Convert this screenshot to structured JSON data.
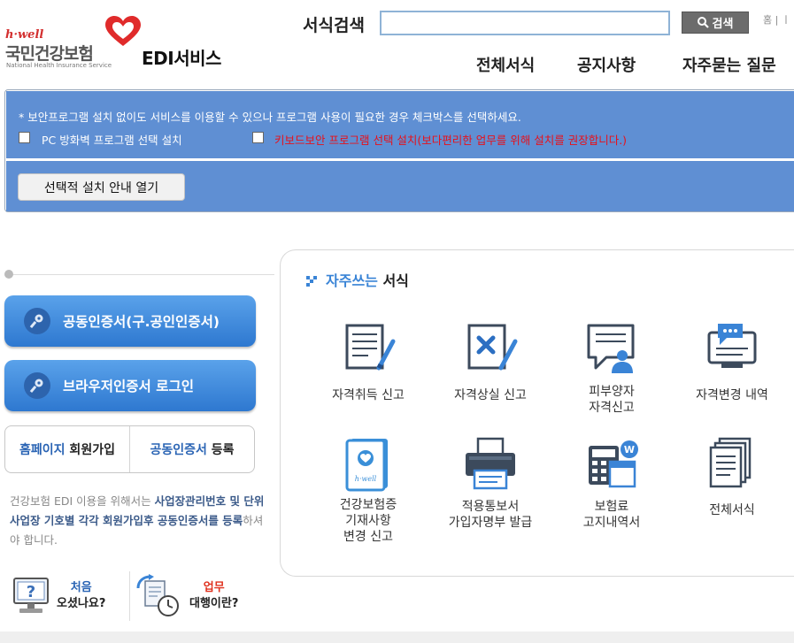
{
  "header": {
    "logo_brand": "h·well",
    "logo_org": "국민건강보험",
    "logo_org_en": "National Health Insurance Service",
    "service_title": "EDI서비스",
    "search_label": "서식검색",
    "search_value": "",
    "search_button": "검색",
    "top_links": "홈 | ㅣ"
  },
  "nav": {
    "items": [
      {
        "label": "전체서식"
      },
      {
        "label": "공지사항"
      },
      {
        "label": "자주묻는 질문"
      }
    ]
  },
  "security": {
    "note": "* 보안프로그램 설치 없이도 서비스를 이용할 수 있으나 프로그램 사용이 필요한 경우 체크박스를 선택하세요.",
    "firewall_label": "PC 방화벽 프로그램 선택 설치",
    "keyboard_label": "키보드보안 프로그램 선택 설치(보다편리한 업무를 위해 설치를 권장합니다.)",
    "guide_button": "선택적 설치 안내 열기",
    "firewall_checked": false,
    "keyboard_checked": false
  },
  "login": {
    "joint_cert": "공동인증서(구.공인인증서)",
    "browser_cert": "브라우저인증서 로그인",
    "signup_hl": "홈페이지",
    "signup_rest": " 회원가입",
    "register_hl": "공동인증서",
    "register_rest": " 등록",
    "info_1": "건강보험 EDI 이용을 위해서는 ",
    "info_2": "사업장관리번호 및 단위 사업장 기호별 각각 회원가입후 공동인증서를 등록",
    "info_3": "하셔야 합니다.",
    "first_a": "처음",
    "first_b": "오셨나요?",
    "agency_a": "업무",
    "agency_b": "대행이란?"
  },
  "freq": {
    "title_a": "자주쓰는",
    "title_b": " 서식",
    "items": [
      {
        "label": "자격취득 신고",
        "icon": "document-pen-icon"
      },
      {
        "label": "자격상실 신고",
        "icon": "document-x-icon"
      },
      {
        "label": "피부양자\n자격신고",
        "icon": "person-board-icon"
      },
      {
        "label": "자격변경 내역",
        "icon": "chat-monitor-icon"
      },
      {
        "label": "건강보험증\n기재사항\n변경 신고",
        "icon": "health-card-icon"
      },
      {
        "label": "적용통보서\n가입자명부 발급",
        "icon": "printer-icon"
      },
      {
        "label": "보험료\n고지내역서",
        "icon": "calculator-icon"
      },
      {
        "label": "전체서식",
        "icon": "document-stack-icon"
      }
    ]
  }
}
